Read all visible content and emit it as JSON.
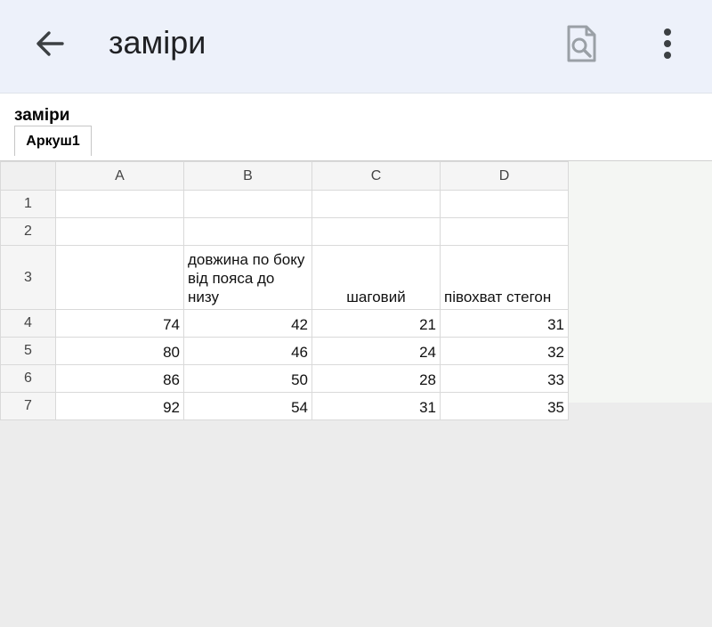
{
  "appbar": {
    "title": "заміри",
    "back_icon": "arrow-left-icon",
    "preview_icon": "document-search-icon",
    "menu_icon": "more-vert-icon"
  },
  "sheet": {
    "doc_title": "заміри",
    "tab_label": "Аркуш1"
  },
  "grid": {
    "columns": [
      "A",
      "B",
      "C",
      "D"
    ],
    "rows": [
      {
        "num": "1",
        "cells": [
          "",
          "",
          "",
          ""
        ]
      },
      {
        "num": "2",
        "cells": [
          "",
          "",
          "",
          ""
        ]
      },
      {
        "num": "3",
        "cells": [
          "",
          "довжина по боку від пояса до низу",
          "шаговий",
          "півохват стегон"
        ]
      },
      {
        "num": "4",
        "cells": [
          "74",
          "42",
          "21",
          "31"
        ]
      },
      {
        "num": "5",
        "cells": [
          "80",
          "46",
          "24",
          "32"
        ]
      },
      {
        "num": "6",
        "cells": [
          "86",
          "50",
          "28",
          "33"
        ]
      },
      {
        "num": "7",
        "cells": [
          "92",
          "54",
          "31",
          "35"
        ]
      }
    ]
  },
  "colors": {
    "appbar_bg": "#edf1fa",
    "page_bg": "#ececec",
    "grid_fill": "#f4f6f3"
  }
}
